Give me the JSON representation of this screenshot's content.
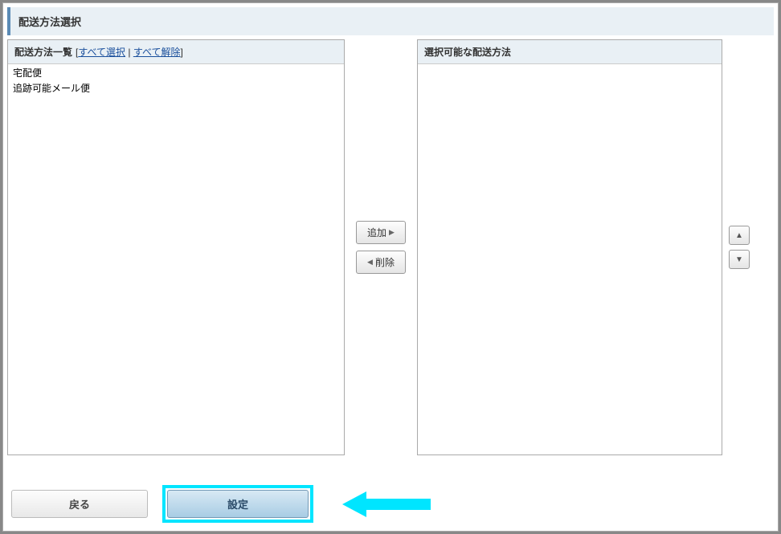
{
  "title": "配送方法選択",
  "leftPanel": {
    "header": "配送方法一覧",
    "selectAllLabel": "すべて選択",
    "deselectAllLabel": "すべて解除",
    "items": [
      "宅配便",
      "追跡可能メール便"
    ]
  },
  "rightPanel": {
    "header": "選択可能な配送方法",
    "items": []
  },
  "transfer": {
    "addLabel": "追加",
    "removeLabel": "削除"
  },
  "buttons": {
    "back": "戻る",
    "settings": "設定"
  }
}
